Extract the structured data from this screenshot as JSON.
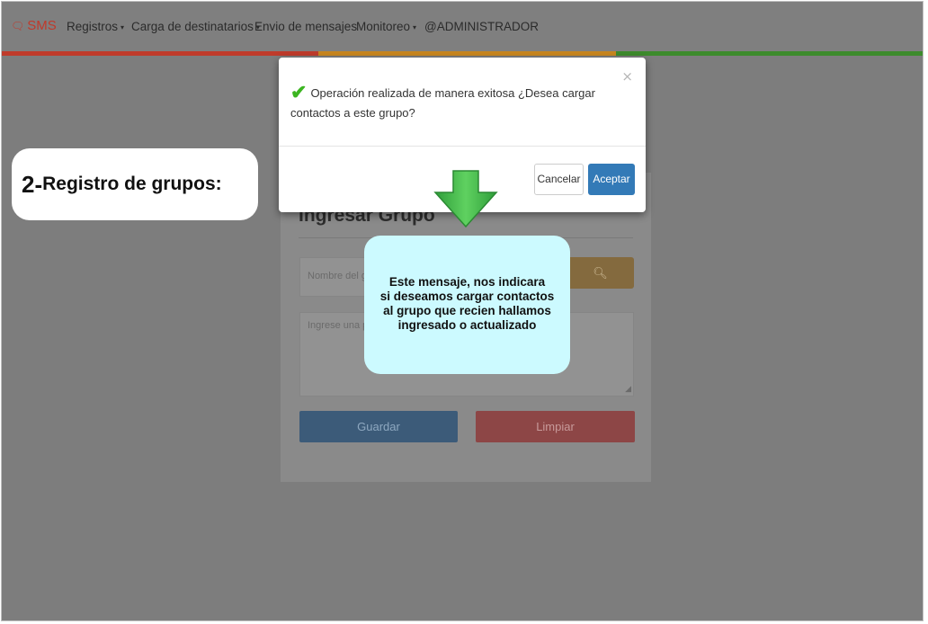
{
  "navbar": {
    "brand": "SMS",
    "items": [
      {
        "label": "Registros",
        "dropdown": true
      },
      {
        "label": "Carga de destinatarios",
        "dropdown": true
      },
      {
        "label": "Envio de mensajes",
        "dropdown": false
      },
      {
        "label": "Monitoreo",
        "dropdown": true
      },
      {
        "label": "@ADMINISTRADOR",
        "dropdown": false
      }
    ]
  },
  "form": {
    "title": "Ingresar Grupo",
    "name_placeholder": "Nombre del gr",
    "description_placeholder": "Ingrese una pr",
    "save_label": "Guardar",
    "clear_label": "Limpiar"
  },
  "modal": {
    "close": "×",
    "message": "Operación realizada de manera exitosa ¿Desea cargar contactos a este grupo?",
    "cancel_label": "Cancelar",
    "accept_label": "Aceptar"
  },
  "annotations": {
    "step_number": "2-",
    "step_title": "Registro de grupos:",
    "tip_lines": [
      "Este mensaje, nos indicara",
      "si deseamos cargar contactos",
      "al grupo que recien hallamos",
      "ingresado o actualizado"
    ]
  },
  "colors": {
    "bar_red": "#bf3b2b",
    "bar_orange": "#c8861f",
    "bar_green": "#3d8b2c",
    "accept_blue": "#337ab7",
    "check_green": "#3cb521",
    "tip_bg": "#ccfaff"
  }
}
